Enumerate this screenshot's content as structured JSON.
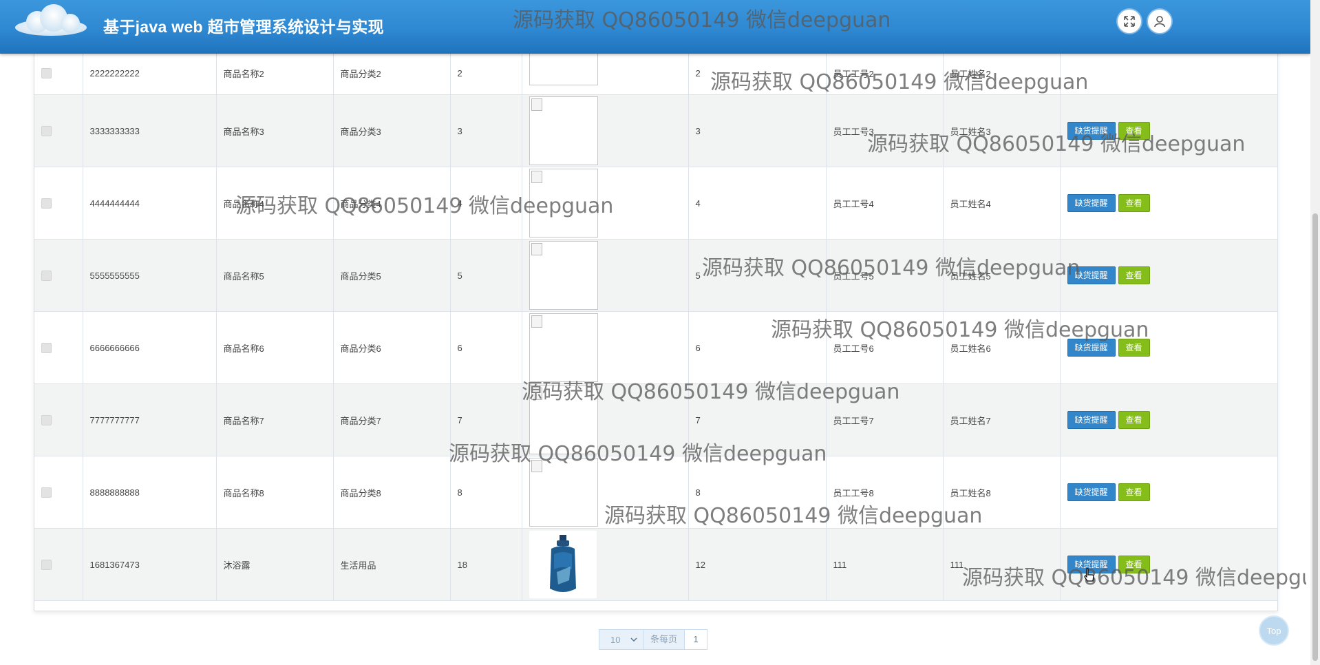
{
  "header": {
    "title": "基于java web 超市管理系统设计与实现",
    "buttons": [
      "fullscreen-icon",
      "user-icon"
    ]
  },
  "buttons": {
    "stock_alert": "缺货提醒",
    "view": "查看"
  },
  "rows": [
    {
      "code": "2222222222",
      "name": "商品名称2",
      "category": "商品分类2",
      "price": "2",
      "image": "broken",
      "stock": "2",
      "emp_no": "员工工号2",
      "emp_name": "员工姓名2"
    },
    {
      "code": "3333333333",
      "name": "商品名称3",
      "category": "商品分类3",
      "price": "3",
      "image": "broken",
      "stock": "3",
      "emp_no": "员工工号3",
      "emp_name": "员工姓名3"
    },
    {
      "code": "4444444444",
      "name": "商品名称4",
      "category": "商品分类4",
      "price": "4",
      "image": "broken",
      "stock": "4",
      "emp_no": "员工工号4",
      "emp_name": "员工姓名4"
    },
    {
      "code": "5555555555",
      "name": "商品名称5",
      "category": "商品分类5",
      "price": "5",
      "image": "broken",
      "stock": "5",
      "emp_no": "员工工号5",
      "emp_name": "员工姓名5"
    },
    {
      "code": "6666666666",
      "name": "商品名称6",
      "category": "商品分类6",
      "price": "6",
      "image": "broken",
      "stock": "6",
      "emp_no": "员工工号6",
      "emp_name": "员工姓名6"
    },
    {
      "code": "7777777777",
      "name": "商品名称7",
      "category": "商品分类7",
      "price": "7",
      "image": "broken",
      "stock": "7",
      "emp_no": "员工工号7",
      "emp_name": "员工姓名7"
    },
    {
      "code": "8888888888",
      "name": "商品名称8",
      "category": "商品分类8",
      "price": "8",
      "image": "broken",
      "stock": "8",
      "emp_no": "员工工号8",
      "emp_name": "员工姓名8"
    },
    {
      "code": "1681367473",
      "name": "沐浴露",
      "category": "生活用品",
      "price": "18",
      "image": "shampoo-bottle",
      "stock": "12",
      "emp_no": "111",
      "emp_name": "111"
    }
  ],
  "pagination": {
    "page_size": "10",
    "per_page_label": "条每页",
    "current_page": "1"
  },
  "top_button": "Top",
  "watermark": "源码获取 QQ86050149 微信deepguan",
  "colors": {
    "header": "#2f88d2",
    "btn_blue": "#3286c9",
    "btn_green": "#85bd1a"
  }
}
